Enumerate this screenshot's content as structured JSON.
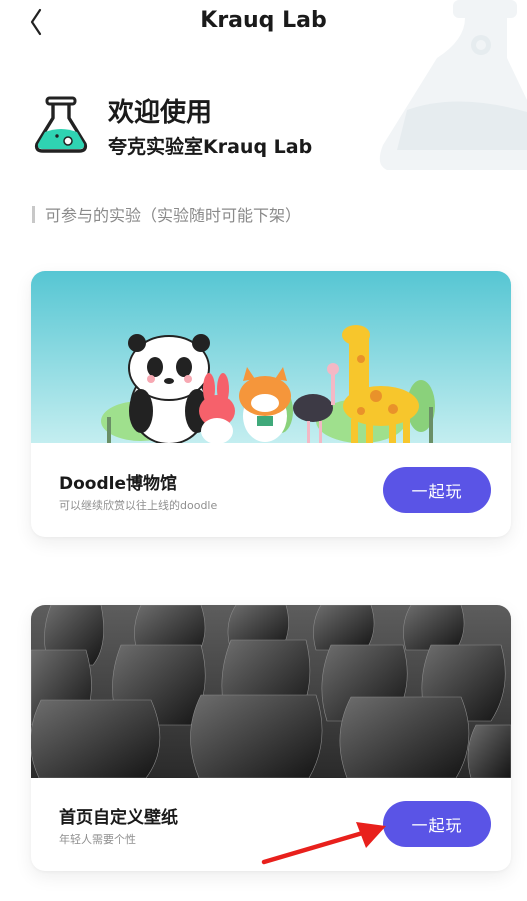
{
  "header": {
    "title": "Krauq Lab",
    "back_icon": "chevron-left-icon"
  },
  "welcome": {
    "title": "欢迎使用",
    "subtitle": "夸克实验室Krauq Lab",
    "icon": "flask-icon"
  },
  "section": {
    "label": "可参与的实验（实验随时可能下架）"
  },
  "experiments": [
    {
      "name": "Doodle博物馆",
      "description": "可以继续欣赏以往上线的doodle",
      "button": "一起玩",
      "image": "doodle-animals-illustration"
    },
    {
      "name": "首页自定义壁纸",
      "description": "年轻人需要个性",
      "button": "一起玩",
      "image": "black-chairs-photo"
    }
  ],
  "colors": {
    "accent": "#5a54e6",
    "flask": "#2fd3b2",
    "annotation_arrow": "#e8201c"
  }
}
